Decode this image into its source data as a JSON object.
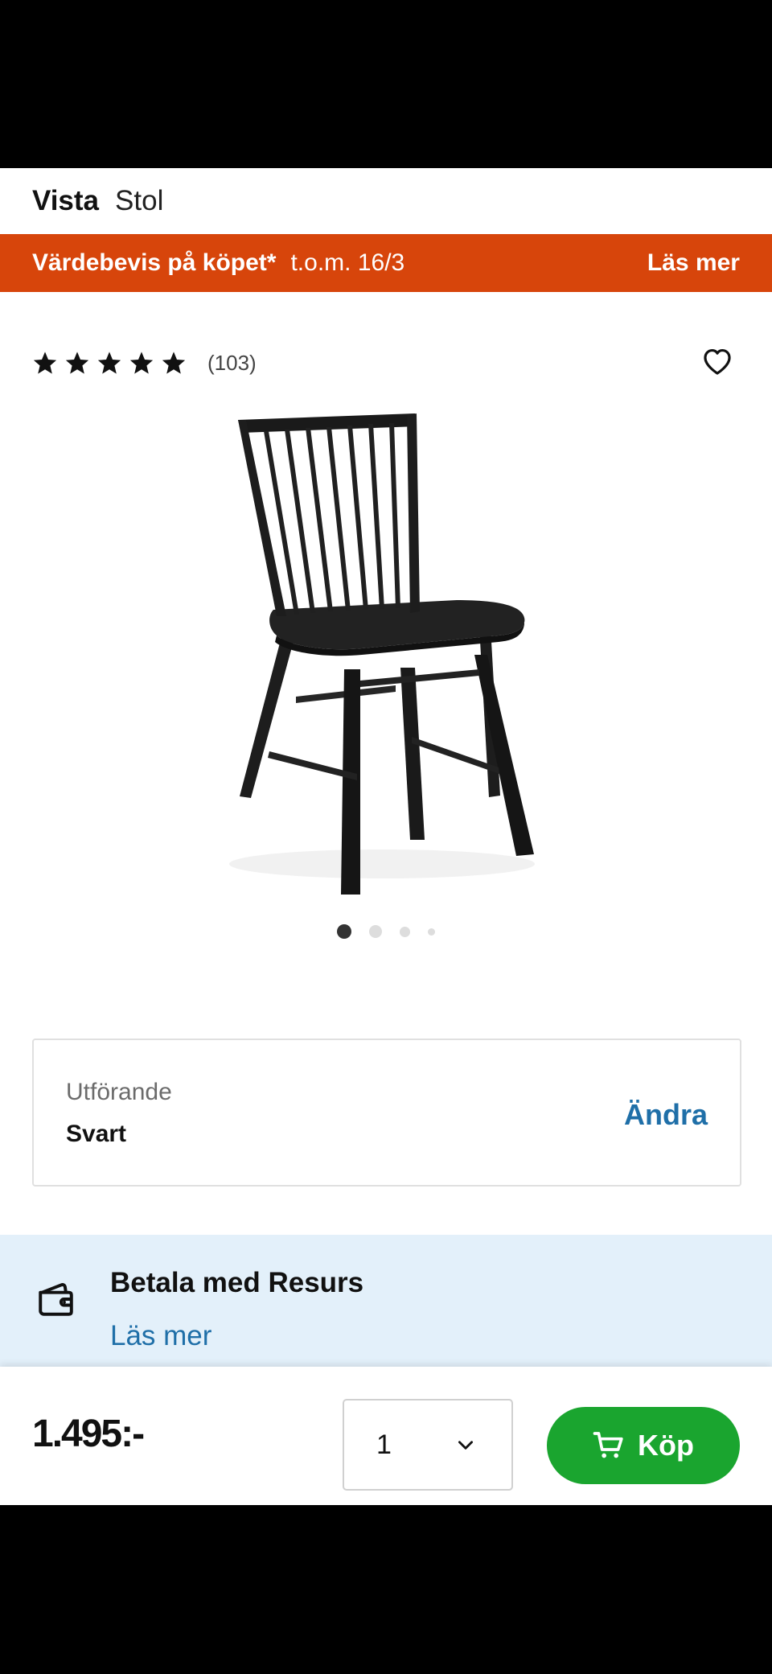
{
  "header": {
    "brand": "Vista",
    "product": "Stol"
  },
  "promo": {
    "title": "Värdebevis på köpet*",
    "date": "t.o.m. 16/3",
    "link": "Läs mer",
    "color": "#d7450b"
  },
  "rating": {
    "stars": 5,
    "count": "(103)",
    "favorite_icon": "heart-outline-icon"
  },
  "gallery": {
    "image_alt": "Vista Stol, svart",
    "slides": 4,
    "active_slide": 1
  },
  "variant": {
    "label": "Utförande",
    "value": "Svart",
    "change": "Ändra"
  },
  "payment": {
    "icon": "wallet-icon",
    "title": "Betala med Resurs",
    "link": "Läs mer",
    "bg": "#e3f0fa"
  },
  "buybar": {
    "price": "1.495:-",
    "quantity": "1",
    "buy_label": "Köp",
    "buy_color": "#1aa52f",
    "link_color": "#1f6fa8"
  }
}
